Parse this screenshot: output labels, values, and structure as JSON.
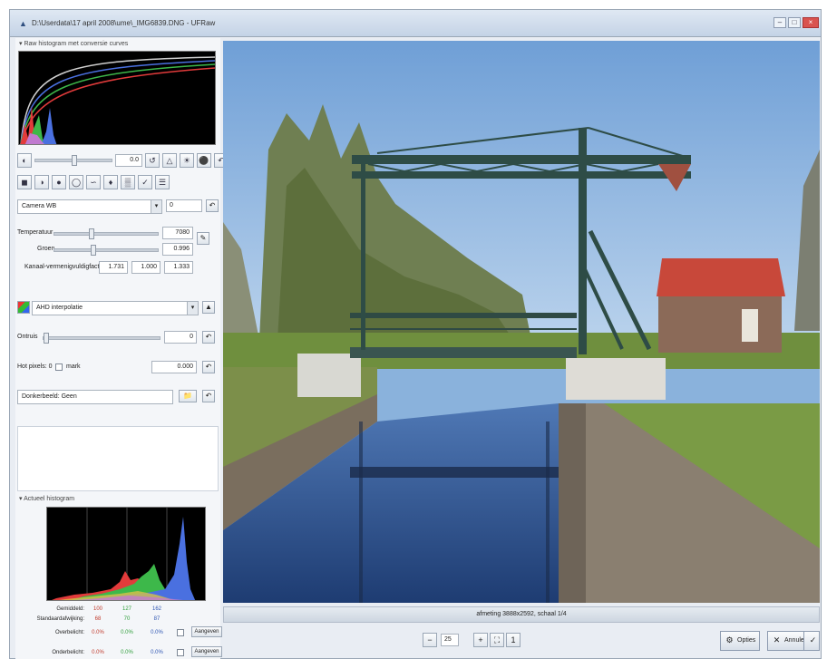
{
  "window": {
    "title": "D:\\Userdata\\17 april 2008\\ume\\_IMG6839.DNG - UFRaw",
    "icon": "app-icon"
  },
  "raw_histogram": {
    "heading": "Raw histogram met conversie curves"
  },
  "toolbar1": {
    "exposure_value": "0.0"
  },
  "white_balance": {
    "preset": "Camera WB",
    "preset_value": "0",
    "temperature_label": "Temperatuur",
    "temperature_value": "7080",
    "green_label": "Groen",
    "green_value": "0.996",
    "multipliers_label": "Kanaal-vermenigvuldigfactoren",
    "mult_r": "1.731",
    "mult_g": "1.000",
    "mult_b": "1.333"
  },
  "interpolation": {
    "value": "AHD interpolatie"
  },
  "denoise": {
    "label": "Ontruis",
    "value": "0"
  },
  "hot_pixels": {
    "label": "Hot pixels: 0",
    "mark_label": "mark",
    "value": "0.000"
  },
  "dark_frame": {
    "label": "Donkerbeeld:",
    "value": "Geen"
  },
  "live_histogram": {
    "heading": "Actueel histogram"
  },
  "stats": {
    "average_label": "Gemiddeld:",
    "average": [
      "100",
      "127",
      "162"
    ],
    "stddev_label": "Standaardafwijking:",
    "stddev": [
      "68",
      "70",
      "87"
    ],
    "over_label": "Overbelicht:",
    "over": [
      "0.0%",
      "0.0%",
      "0.0%"
    ],
    "under_label": "Onderbelicht:",
    "under": [
      "0.0%",
      "0.0%",
      "0.0%"
    ],
    "indicate_button": "Aangeven"
  },
  "caption": "afmeting 3888x2592, schaal 1/4",
  "zoom": {
    "value": "25"
  },
  "buttons": {
    "options": "Opties",
    "cancel": "Annuleren",
    "save": "OK"
  },
  "colors": {
    "accent_red": "#c0392b",
    "accent_green": "#2e9e3a",
    "accent_blue": "#2f56b3"
  }
}
